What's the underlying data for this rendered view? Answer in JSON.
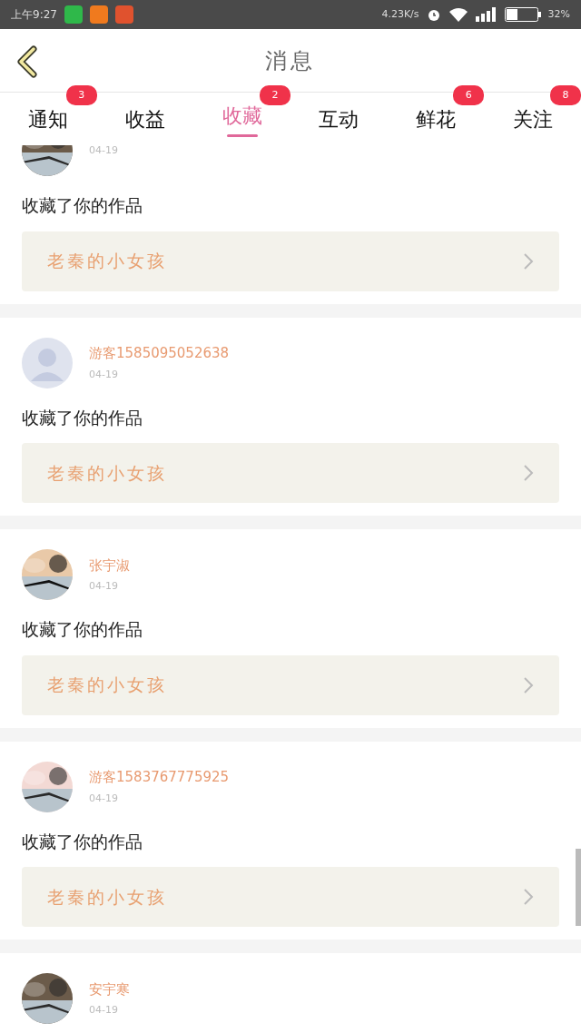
{
  "status_bar": {
    "time": "上午9:27",
    "network_speed": "4.23K/s",
    "battery_percent": "32%"
  },
  "header": {
    "title": "消息"
  },
  "tabs": [
    {
      "label": "通知",
      "badge": "3",
      "selected": false
    },
    {
      "label": "收益",
      "selected": false
    },
    {
      "label": "收藏",
      "badge": "2",
      "selected": true
    },
    {
      "label": "互动",
      "selected": false
    },
    {
      "label": "鲜花",
      "badge": "6",
      "selected": false
    },
    {
      "label": "关注",
      "badge": "8",
      "selected": false
    }
  ],
  "messages": [
    {
      "date": "04-19",
      "action": "收藏了你的作品",
      "work": "老秦的小女孩"
    },
    {
      "name": "游客1585095052638",
      "date": "04-19",
      "action": "收藏了你的作品",
      "work": "老秦的小女孩",
      "avatar": {
        "kind": "default"
      }
    },
    {
      "name": "张宇淑",
      "date": "04-19",
      "action": "收藏了你的作品",
      "work": "老秦的小女孩"
    },
    {
      "name": "游客1583767775925",
      "date": "04-19",
      "action": "收藏了你的作品",
      "work": "老秦的小女孩"
    },
    {
      "name": "安宇寒",
      "date": "04-19"
    }
  ]
}
